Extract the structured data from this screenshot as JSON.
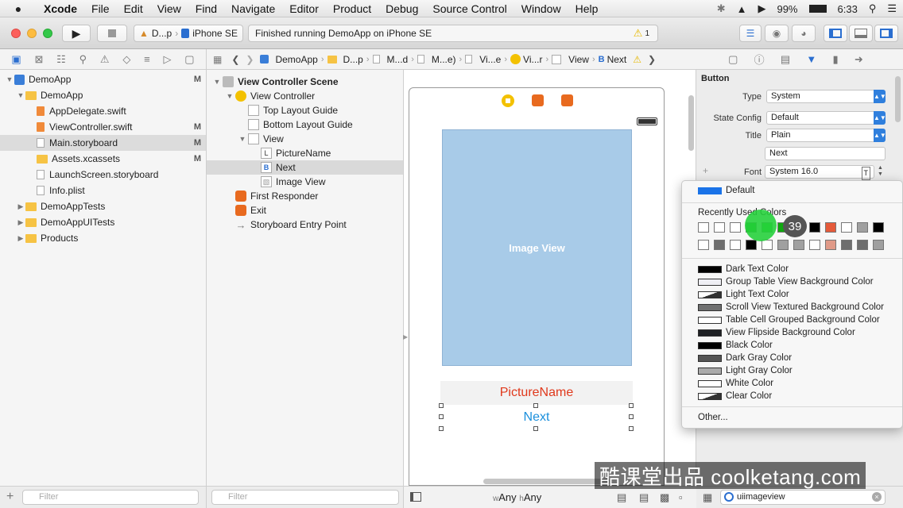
{
  "menubar": {
    "apple": "",
    "app": "Xcode",
    "items": [
      "File",
      "Edit",
      "View",
      "Find",
      "Navigate",
      "Editor",
      "Product",
      "Debug",
      "Source Control",
      "Window",
      "Help"
    ],
    "battery": "99%",
    "time": "6:33"
  },
  "toolbar": {
    "scheme": "D...p",
    "device": "iPhone SE",
    "activity": "Finished running DemoApp on iPhone SE",
    "warnings": "1"
  },
  "navigator": {
    "items": [
      {
        "label": "DemoApp",
        "mark": "M",
        "kind": "app",
        "indent": 0,
        "disc": "▼",
        "sel": false
      },
      {
        "label": "DemoApp",
        "mark": "",
        "kind": "folder",
        "indent": 1,
        "disc": "▼",
        "sel": false
      },
      {
        "label": "AppDelegate.swift",
        "mark": "",
        "kind": "swift",
        "indent": 2,
        "disc": "",
        "sel": false
      },
      {
        "label": "ViewController.swift",
        "mark": "M",
        "kind": "swift",
        "indent": 2,
        "disc": "",
        "sel": false
      },
      {
        "label": "Main.storyboard",
        "mark": "M",
        "kind": "file",
        "indent": 2,
        "disc": "",
        "sel": true
      },
      {
        "label": "Assets.xcassets",
        "mark": "M",
        "kind": "folder",
        "indent": 2,
        "disc": "",
        "sel": false
      },
      {
        "label": "LaunchScreen.storyboard",
        "mark": "",
        "kind": "file",
        "indent": 2,
        "disc": "",
        "sel": false
      },
      {
        "label": "Info.plist",
        "mark": "",
        "kind": "file",
        "indent": 2,
        "disc": "",
        "sel": false
      },
      {
        "label": "DemoAppTests",
        "mark": "",
        "kind": "folder",
        "indent": 1,
        "disc": "▶",
        "sel": false
      },
      {
        "label": "DemoAppUITests",
        "mark": "",
        "kind": "folder",
        "indent": 1,
        "disc": "▶",
        "sel": false
      },
      {
        "label": "Products",
        "mark": "",
        "kind": "folder",
        "indent": 1,
        "disc": "▶",
        "sel": false
      }
    ],
    "filter_placeholder": "Filter"
  },
  "jumpbar": {
    "segments": [
      "DemoApp",
      "D...p",
      "M...d",
      "M...e)",
      "Vi...e",
      "Vi...r",
      "View",
      "Next"
    ]
  },
  "outline": {
    "items": [
      {
        "label": "View Controller Scene",
        "icon": "scene",
        "indent": 0,
        "disc": "▼",
        "bold": true,
        "sel": false
      },
      {
        "label": "View Controller",
        "icon": "vc",
        "indent": 1,
        "disc": "▼",
        "bold": false,
        "sel": false
      },
      {
        "label": "Top Layout Guide",
        "icon": "guide",
        "indent": 2,
        "disc": "",
        "bold": false,
        "sel": false
      },
      {
        "label": "Bottom Layout Guide",
        "icon": "guide",
        "indent": 2,
        "disc": "",
        "bold": false,
        "sel": false
      },
      {
        "label": "View",
        "icon": "view",
        "indent": 2,
        "disc": "▼",
        "bold": false,
        "sel": false
      },
      {
        "label": "PictureName",
        "icon": "L",
        "indent": 3,
        "disc": "",
        "bold": false,
        "sel": false
      },
      {
        "label": "Next",
        "icon": "B",
        "indent": 3,
        "disc": "",
        "bold": false,
        "sel": true
      },
      {
        "label": "Image View",
        "icon": "img",
        "indent": 3,
        "disc": "",
        "bold": false,
        "sel": false
      },
      {
        "label": "First Responder",
        "icon": "fr",
        "indent": 1,
        "disc": "",
        "bold": false,
        "sel": false
      },
      {
        "label": "Exit",
        "icon": "exit",
        "indent": 1,
        "disc": "",
        "bold": false,
        "sel": false
      },
      {
        "label": "Storyboard Entry Point",
        "icon": "arrow",
        "indent": 1,
        "disc": "",
        "bold": false,
        "sel": false
      }
    ],
    "filter_placeholder": "Filter"
  },
  "canvas": {
    "image_view": "Image View",
    "picture_name": "PictureName",
    "next": "Next",
    "size_w": "Any",
    "size_h": "Any",
    "w_prefix": "w",
    "h_prefix": "h"
  },
  "inspector": {
    "section": "Button",
    "type_label": "Type",
    "type_value": "System",
    "state_label": "State Config",
    "state_value": "Default",
    "title_label": "Title",
    "title_value": "Plain",
    "title_text": "Next",
    "font_label": "Font",
    "font_value": "System 16.0",
    "bottom_search": "uiimageview"
  },
  "popup": {
    "default": "Default",
    "recent_label": "Recently Used Colors",
    "badge": "39",
    "other": "Other...",
    "row1": [
      "#ffffff",
      "#ffffff",
      "#ffffff",
      "#0fa80f",
      "#1ad31a",
      "#0fa80f",
      "#ffffff",
      "#000000",
      "#e55a3a",
      "#ffffff",
      "#a0a0a0",
      "#000000"
    ],
    "row2": [
      "#ffffff",
      "#6e6e6e",
      "#ffffff",
      "#000000",
      "#ffffff",
      "#a0a0a0",
      "#a0a0a0",
      "#ffffff",
      "#e09a88",
      "#6e6e6e",
      "#6e6e6e",
      "#a0a0a0"
    ],
    "colors": [
      {
        "label": "Dark Text Color",
        "fill": "#000000"
      },
      {
        "label": "Group Table View Background Color",
        "fill": "#efeff4"
      },
      {
        "label": "Light Text Color",
        "fill": "#cccccc"
      },
      {
        "label": "Scroll View Textured Background Color",
        "fill": "#6f7070"
      },
      {
        "label": "Table Cell Grouped Background Color",
        "fill": "#ffffff"
      },
      {
        "label": "View Flipside Background Color",
        "fill": "#1f2124"
      },
      {
        "label": "Black Color",
        "fill": "#000000"
      },
      {
        "label": "Dark Gray Color",
        "fill": "#555555"
      },
      {
        "label": "Light Gray Color",
        "fill": "#aaaaaa"
      },
      {
        "label": "White Color",
        "fill": "#ffffff"
      },
      {
        "label": "Clear Color",
        "fill": "#ffffff"
      }
    ]
  },
  "watermark": "酷课堂出品 coolketang.com"
}
